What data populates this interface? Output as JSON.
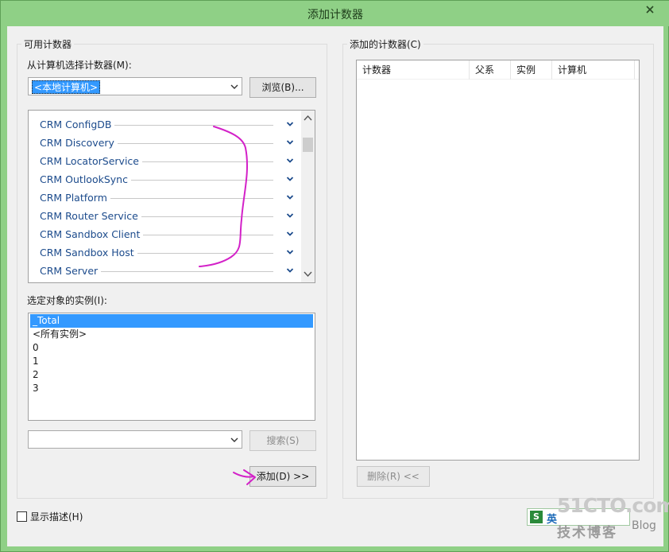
{
  "window": {
    "title": "添加计数器",
    "close_label": "✕"
  },
  "available": {
    "group_label": "可用计数器",
    "computer_label": "从计算机选择计数器(M):",
    "computer_value": "<本地计算机>",
    "browse_button": "浏览(B)...",
    "counters": [
      "CRM ConfigDB",
      "CRM Discovery",
      "CRM LocatorService",
      "CRM OutlookSync",
      "CRM Platform",
      "CRM Router Service",
      "CRM Sandbox Client",
      "CRM Sandbox Host",
      "CRM Server"
    ],
    "instances_label": "选定对象的实例(I):",
    "instances": [
      "_Total",
      "<所有实例>",
      "0",
      "1",
      "2",
      "3"
    ],
    "selected_instance": "_Total",
    "search_value": "",
    "search_button": "搜索(S)",
    "add_button": "添加(D) >>"
  },
  "added": {
    "group_label": "添加的计数器(C)",
    "columns": [
      "计数器",
      "父系",
      "实例",
      "计算机"
    ],
    "remove_button": "删除(R) <<"
  },
  "footer": {
    "show_description": "显示描述(H)",
    "show_description_checked": false
  },
  "watermark": {
    "brand": "51CTO.com",
    "tagline": "技术博客",
    "blog": "Blog",
    "ime_glyph": "S",
    "ime_lang": "英"
  },
  "colors": {
    "title_bar": "#8fd086",
    "selection": "#3399ff",
    "counter_text": "#1c4b8c",
    "annotation": "#d321c8"
  }
}
